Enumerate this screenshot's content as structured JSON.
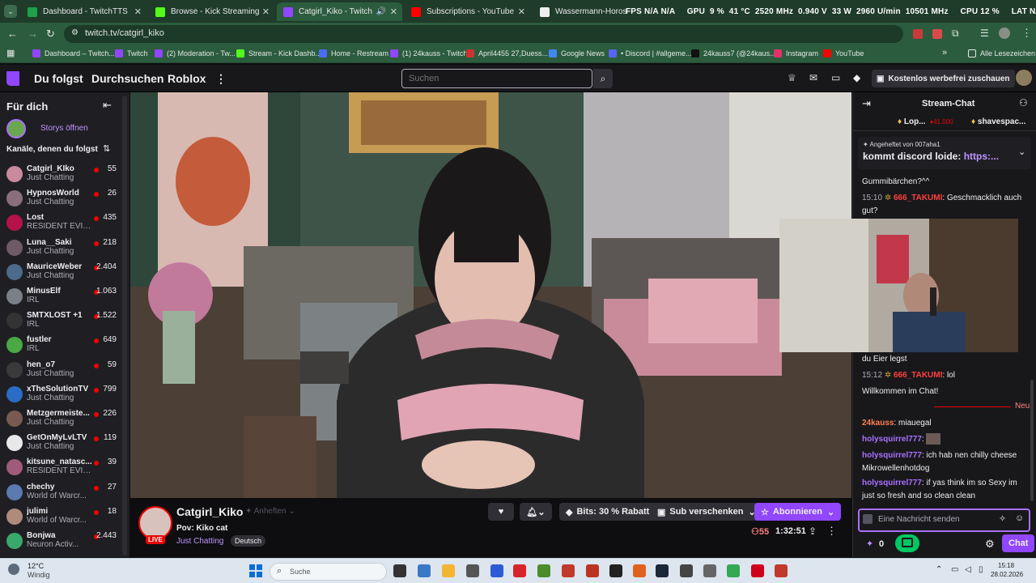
{
  "browser": {
    "tabs": [
      {
        "label": "Dashboard - TwitchTTS",
        "color": "#1fa04b"
      },
      {
        "label": "Browse - Kick Streaming",
        "color": "#53fc18"
      },
      {
        "label": "Catgirl_Kiko - Twitch",
        "color": "#9146ff"
      },
      {
        "label": "Subscriptions - YouTube",
        "color": "#ff0000"
      },
      {
        "label": "Wassermann-Horoskop: Sonne",
        "color": "#222222"
      }
    ],
    "overlay_stats": "FPS N/A N/A     GPU  9 %  41 °C  2520 MHz  0.940 V  33 W  2960 U/min  10501 MHz     CPU 12 %     LAT N/A N/A",
    "url": "twitch.tv/catgirl_kiko",
    "bookmarks": [
      {
        "label": "Dashboard – Twitch...",
        "color": "#9146ff"
      },
      {
        "label": "Twitch",
        "color": "#9146ff"
      },
      {
        "label": "(2) Moderation - Tw...",
        "color": "#9146ff"
      },
      {
        "label": "Stream - Kick Dashb...",
        "color": "#53fc18"
      },
      {
        "label": "Home - Restream",
        "color": "#4a6cf7"
      },
      {
        "label": "(1) 24kauss - Twitch",
        "color": "#9146ff"
      },
      {
        "label": "April4455 27,Duess...",
        "color": "#cc3333"
      },
      {
        "label": "Google News",
        "color": "#4285f4"
      },
      {
        "label": "• Discord | #allgeme...",
        "color": "#5865f2"
      },
      {
        "label": "24kauss7 (@24kaus...",
        "color": "#111111"
      },
      {
        "label": "Instagram",
        "color": "#e1306c"
      },
      {
        "label": "YouTube",
        "color": "#ff0000"
      }
    ],
    "all_bookmarks": "Alle Lesezeichen"
  },
  "topnav": {
    "following": "Du folgst",
    "browse": "Durchsuchen",
    "game": "Roblox",
    "search_placeholder": "Suchen",
    "adfree": "Kostenlos werbefrei zuschauen"
  },
  "sidebar": {
    "for_you": "Für dich",
    "stories": "Storys öffnen",
    "followed_header": "Kanäle, denen du folgst",
    "channels": [
      {
        "name": "Catgirl_KIko",
        "game": "Just Chatting",
        "viewers": "55",
        "color": "#c98a9e"
      },
      {
        "name": "HypnosWorld",
        "game": "Just Chatting",
        "viewers": "26",
        "color": "#8a6f7a"
      },
      {
        "name": "Lost",
        "game": "RESIDENT EVIL...",
        "viewers": "435",
        "color": "#b5124a"
      },
      {
        "name": "Luna__Saki",
        "game": "Just Chatting",
        "viewers": "218",
        "color": "#6e5a66"
      },
      {
        "name": "MauriceWeber",
        "game": "Just Chatting",
        "viewers": "2.404",
        "color": "#4c6a8a"
      },
      {
        "name": "MinusElf",
        "game": "IRL",
        "viewers": "1.063",
        "color": "#7a7f88"
      },
      {
        "name": "SMTXLOST +1",
        "game": "IRL",
        "viewers": "1.522",
        "color": "#333333"
      },
      {
        "name": "fustler",
        "game": "IRL",
        "viewers": "649",
        "color": "#4aa845"
      },
      {
        "name": "hen_o7",
        "game": "Just Chatting",
        "viewers": "59",
        "color": "#3a3a3a"
      },
      {
        "name": "xTheSolutionTV",
        "game": "Just Chatting",
        "viewers": "799",
        "color": "#2b6cc4"
      },
      {
        "name": "Metzgermeiste...",
        "game": "Just Chatting",
        "viewers": "226",
        "color": "#7a5a50"
      },
      {
        "name": "GetOnMyLvLTV",
        "game": "Just Chatting",
        "viewers": "119",
        "color": "#e8e8e8"
      },
      {
        "name": "kitsune_natasc...",
        "game": "RESIDENT EVIL...",
        "viewers": "39",
        "color": "#a05a7a"
      },
      {
        "name": "chechy",
        "game": "World of Warcr...",
        "viewers": "27",
        "color": "#5a7ab0"
      },
      {
        "name": "julimi",
        "game": "World of Warcr...",
        "viewers": "18",
        "color": "#b08a7a"
      },
      {
        "name": "Bonjwa",
        "game": "Neuron Activ...",
        "viewers": "2.443",
        "color": "#3aa86a"
      }
    ]
  },
  "stream": {
    "channel": "Catgirl_Kiko",
    "live": "LIVE",
    "pin": "Anheften",
    "title": "Pov: Kiko cat",
    "category": "Just Chatting",
    "tag": "Deutsch",
    "bits": "Bits: 30 % Rabatt",
    "gift": "Sub verschenken",
    "subscribe": "Abonnieren",
    "viewers": "55",
    "uptime": "1:32:51"
  },
  "chat": {
    "title": "Stream-Chat",
    "leaders": [
      {
        "name": "Lop...",
        "bits": "41.000"
      },
      {
        "name": "shavespac...",
        "bits": ""
      }
    ],
    "pinned_by": "Angeheftet von 007aha1",
    "pinned_text": "kommt discord loide:",
    "pinned_link": "https:...",
    "messages": [
      {
        "text": "Gummibärchen?^^"
      },
      {
        "time": "15:10",
        "user": "666_TAKUMI",
        "text": "Geschmacklich auch gut?"
      },
      {
        "text": "du Eier legst"
      },
      {
        "time": "15:12",
        "user": "666_TAKUMI",
        "text": "lol"
      },
      {
        "text": "Willkommen im Chat!"
      }
    ],
    "new_label": "Neu",
    "recent": [
      {
        "user": "24kauss",
        "text": "miauegal",
        "color": "#ff7f50"
      },
      {
        "user": "holysquirrel777",
        "text": "",
        "color": "#a970ff"
      },
      {
        "user": "holysquirrel777",
        "text": "ich hab nen chilly cheese Mikrowellenhotdog",
        "color": "#a970ff"
      },
      {
        "user": "holysquirrel777",
        "text": "if yas think im so Sexy im just so fresh and so clean clean",
        "color": "#a970ff"
      }
    ],
    "input_placeholder": "Eine Nachricht senden",
    "points": "0",
    "send": "Chat"
  },
  "taskbar": {
    "temp": "12°C",
    "weather": "Windig",
    "search": "Suche",
    "time": "15:18",
    "date": "28.02.2026"
  }
}
